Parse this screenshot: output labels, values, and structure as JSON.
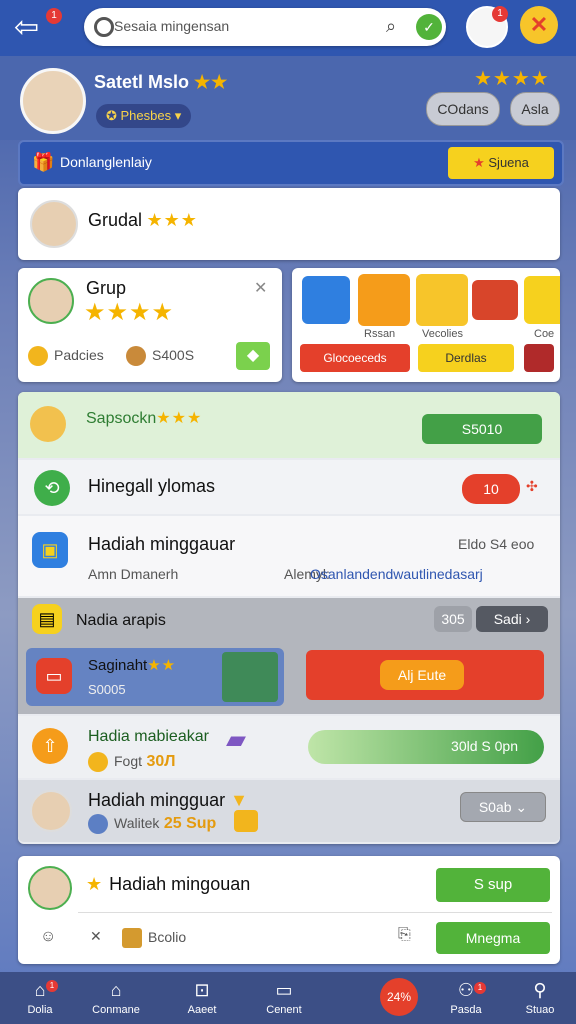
{
  "topbar": {
    "notif_count": "1",
    "search_placeholder": "Sesaia mingensan",
    "avatar_badge": "1"
  },
  "profile": {
    "name": "Satetl Mslo",
    "name_stars": "★★",
    "badge": "Phesbes",
    "stars": "★★★★",
    "btn_codes": "COdans",
    "btn_ask": "Asla"
  },
  "banner": {
    "text": "Donlanglenlaiy",
    "button": "Sjuena"
  },
  "card_grudal": {
    "title": "Grudal",
    "stars": "★★★"
  },
  "card_grup": {
    "title": "Grup",
    "stars": "★★★★",
    "label_left": "Padcies",
    "label_right": "S400S"
  },
  "card_gifts": {
    "label1": "Rssan",
    "label2": "Vecolies",
    "label3": "Coe",
    "btn_red": "Glocoeceds",
    "btn_yellow": "Derdlas"
  },
  "list": {
    "row1": {
      "title": "Sapsockn",
      "stars": "★★★",
      "value": "S5010"
    },
    "row2": {
      "title": "Hinegall ylomas",
      "value": "10"
    },
    "row3": {
      "title": "Hadiah minggauar",
      "right": "Eldo S4 eoo",
      "sub_left": "Amn Dmanerh",
      "sub_mid": "Alemyl:",
      "sub_link": "Osanlandendwautlinedasarj"
    },
    "row4": {
      "title": "Nadia arapis",
      "chip": "305",
      "select": "Sadi"
    },
    "row5": {
      "title": "Saginaht",
      "stars": "★★",
      "sub": "S0005",
      "button": "Alj Eute"
    },
    "row6": {
      "title": "Hadia mabieakar",
      "sub": "Fogt",
      "value": "30Л",
      "bar": "30ld  S 0pn"
    },
    "row7": {
      "title": "Hadiah mingguar",
      "sub": "Walitek",
      "value": "25 Sup",
      "select": "S0ab"
    }
  },
  "footer_card": {
    "title": "Hadiah mingouan",
    "btn_top": "S sup",
    "sub": "Bcolio",
    "btn_bottom": "Mnegma"
  },
  "bottom_nav": {
    "items": [
      "Dolia",
      "Conmane",
      "Aaeet",
      "Cenent",
      "24%",
      "Pasda",
      "Stuao"
    ],
    "notif1": "1",
    "notif2": "1"
  },
  "colors": {
    "topbar": "#2f56b0",
    "green": "#52b33a",
    "red": "#e4402b",
    "gold": "#f5b400"
  }
}
